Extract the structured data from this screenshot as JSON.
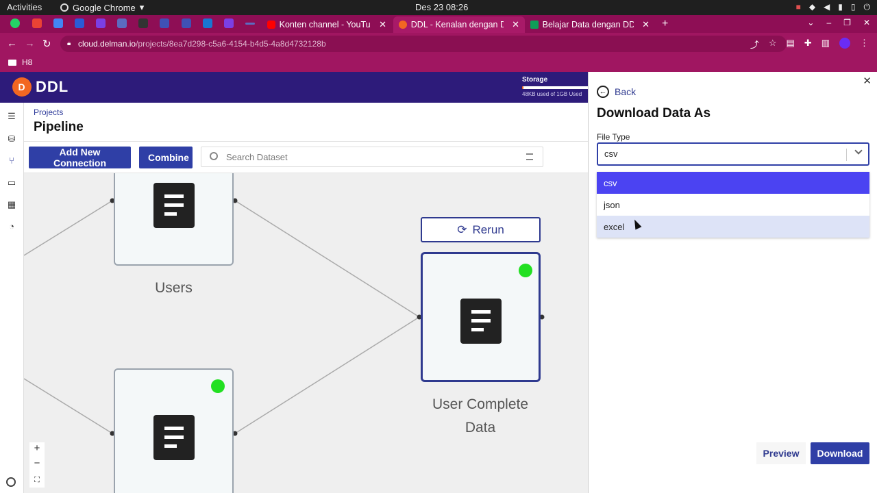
{
  "os_bar": {
    "activities": "Activities",
    "app_name": "Google Chrome",
    "clock": "Des 23  08:26"
  },
  "browser": {
    "tabs": [
      {
        "title": "Konten channel - YouTube",
        "favicon_color": "#ff0000"
      },
      {
        "title": "DDL - Kenalan dengan DDL",
        "favicon_color": "#f26722",
        "active": true
      },
      {
        "title": "Belajar Data dengan DDL",
        "favicon_color": "#0f9d58"
      }
    ],
    "url_host": "cloud.delman.io",
    "url_path": "/projects/8ea7d298-c5a6-4154-b4d5-4a8d4732128b",
    "bookmark_folder": "H8"
  },
  "app": {
    "logo_text": "DDL",
    "storage": {
      "label": "Storage",
      "used_text": "48KB used of 1GB Used",
      "used_fraction": 0.02
    },
    "breadcrumb": "Projects",
    "page_title": "Pipeline",
    "toolbar": {
      "add_connection": "Add New Connection",
      "combine": "Combine",
      "search_placeholder": "Search Dataset"
    },
    "canvas": {
      "nodes": [
        {
          "label": "Users"
        },
        {
          "label": "User Complete Data",
          "line1": "User Complete",
          "line2": "Data"
        }
      ],
      "rerun_label": "Rerun",
      "zoom": {
        "in": "+",
        "out": "−"
      }
    }
  },
  "panel": {
    "back_label": "Back",
    "title": "Download Data As",
    "file_type_label": "File Type",
    "selected": "csv",
    "options": [
      "csv",
      "json",
      "excel"
    ],
    "preview_label": "Preview",
    "download_label": "Download"
  },
  "colors": {
    "brand_primary": "#2f3fa6",
    "header": "#2d1b7a",
    "chrome": "#a01661",
    "status_ok": "#22e022",
    "accent": "#f26722"
  }
}
